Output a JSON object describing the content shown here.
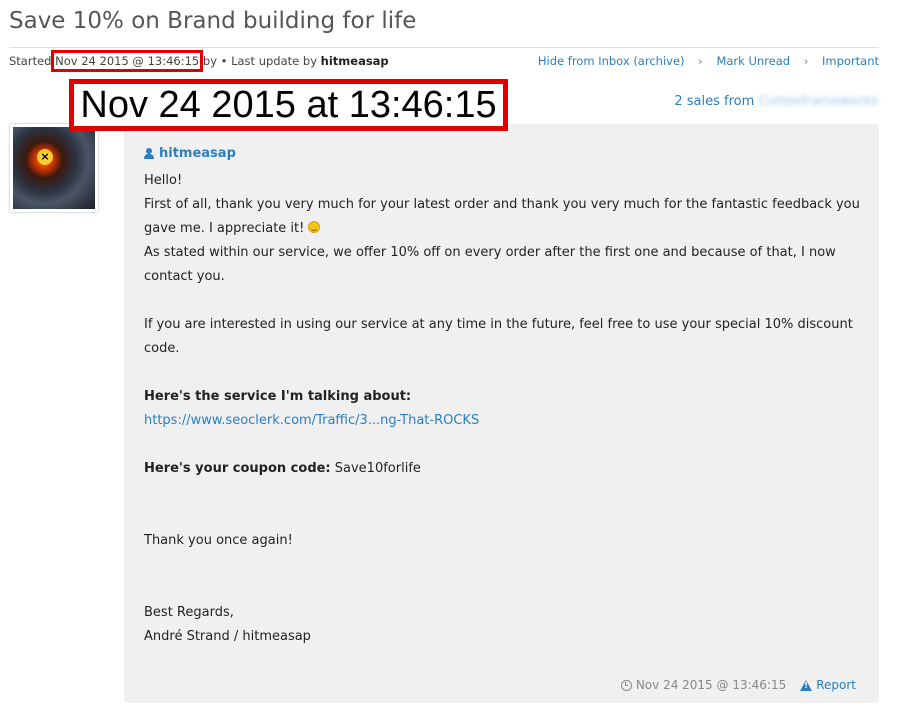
{
  "title": "Save 10% on Brand building for life",
  "meta": {
    "started_label": "Started",
    "started_date": "Nov 24 2015 @ 13:46:15",
    "by_text": " by • Last update by",
    "last_user": "hitmeasap",
    "actions": [
      "Hide from Inbox (archive)",
      "Mark Unread",
      "Important"
    ],
    "separator": "›"
  },
  "annotation": {
    "big_date": "Nov 24 2015 at 13:46:15",
    "highlight_color": "#e00000"
  },
  "sales": {
    "prefix": "2 sales from",
    "seller_blurred": "Cortexframeworks"
  },
  "message": {
    "author": "hitmeasap",
    "lines": {
      "greeting": "Hello!",
      "thanks_1": "First of all, thank you very much for your latest order and thank you very much for the fantastic feedback you",
      "thanks_2": "gave me. I appreciate it!",
      "offer_1": "As stated within our service, we offer 10% off on every order after the first one and because of that, I now",
      "offer_2": "contact you.",
      "interest_1": "If you are interested in using our service at any time in the future, feel free to use your special 10% discount",
      "interest_2": "code.",
      "service_label": "Here's the service I'm talking about:",
      "service_link": "https://www.seoclerk.com/Traffic/3...ng-That-ROCKS",
      "coupon_label": "Here's your coupon code:",
      "coupon_code": " Save10forlife",
      "thank_again": "Thank you once again!",
      "regards": "Best Regards,",
      "signature": "André Strand / hitmeasap"
    },
    "timestamp": "Nov 24 2015 @ 13:46:15",
    "report_label": "Report"
  },
  "colors": {
    "link": "#2a7fbf",
    "message_bg": "#f0f0f0",
    "title": "#555555"
  }
}
